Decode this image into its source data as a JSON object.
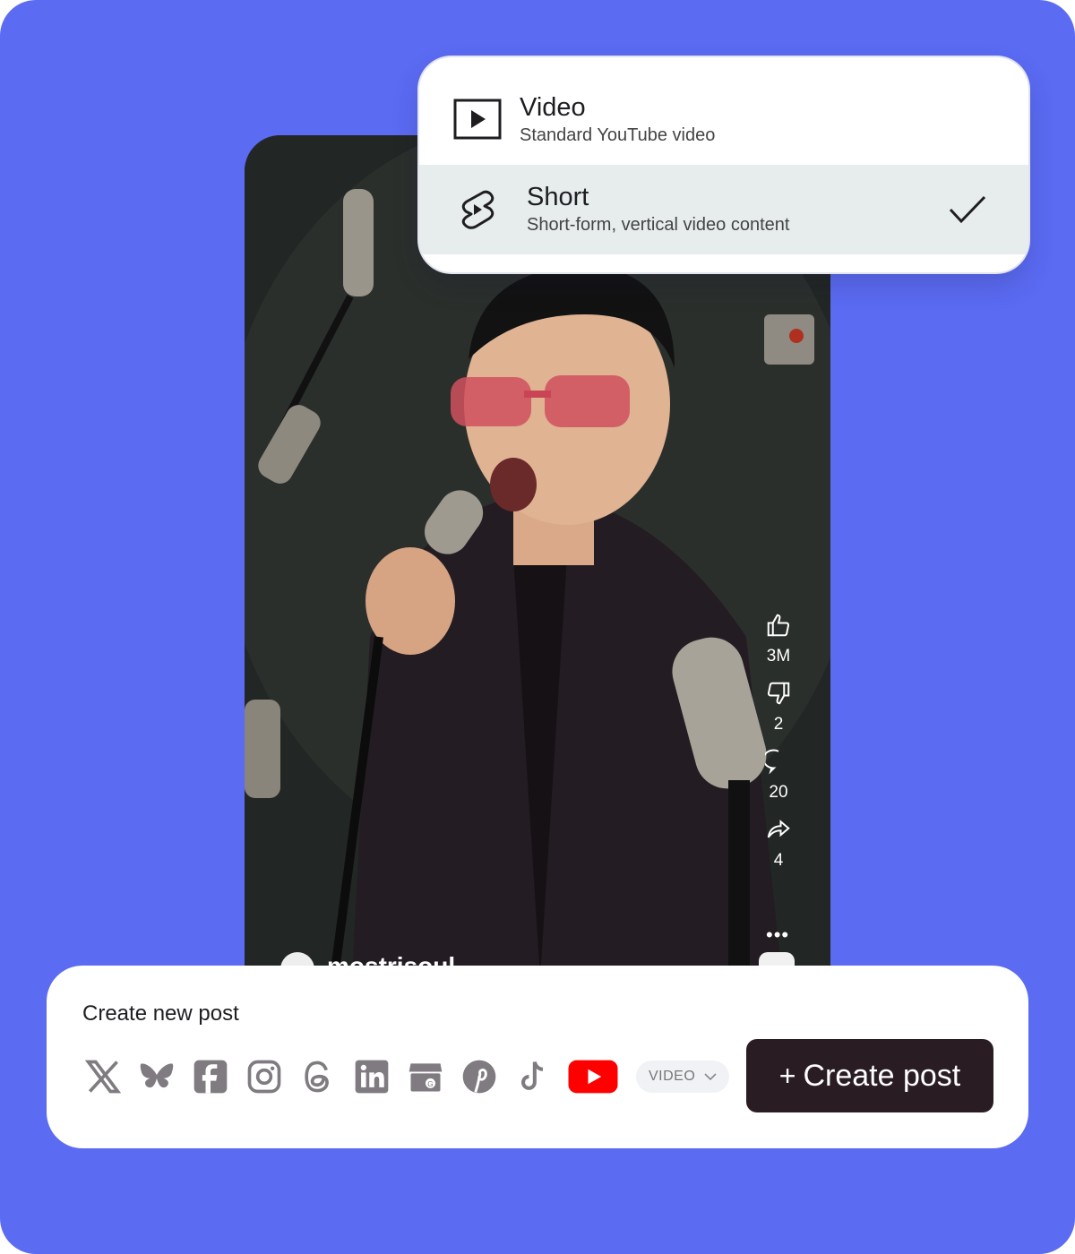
{
  "dropdown": {
    "options": [
      {
        "title": "Video",
        "description": "Standard YouTube video",
        "icon": "play-box-icon",
        "selected": false
      },
      {
        "title": "Short",
        "description": "Short-form, vertical video content",
        "icon": "youtube-shorts-icon",
        "selected": true
      }
    ]
  },
  "preview": {
    "likes": "3M",
    "dislikes": "2",
    "comments": "20",
    "shares": "4",
    "channel": "mostrisoul"
  },
  "composer": {
    "title": "Create new post",
    "networks": [
      "x-icon",
      "bluesky-icon",
      "facebook-icon",
      "instagram-icon",
      "threads-icon",
      "linkedin-icon",
      "google-business-icon",
      "pinterest-icon",
      "tiktok-icon",
      "youtube-icon"
    ],
    "post_type": "VIDEO",
    "create_plus": "+",
    "create_label": "Create post"
  },
  "colors": {
    "background": "#5b6bf2",
    "youtube_red": "#ff0000",
    "button": "#2a1c23",
    "selected_row": "#e6edec"
  }
}
